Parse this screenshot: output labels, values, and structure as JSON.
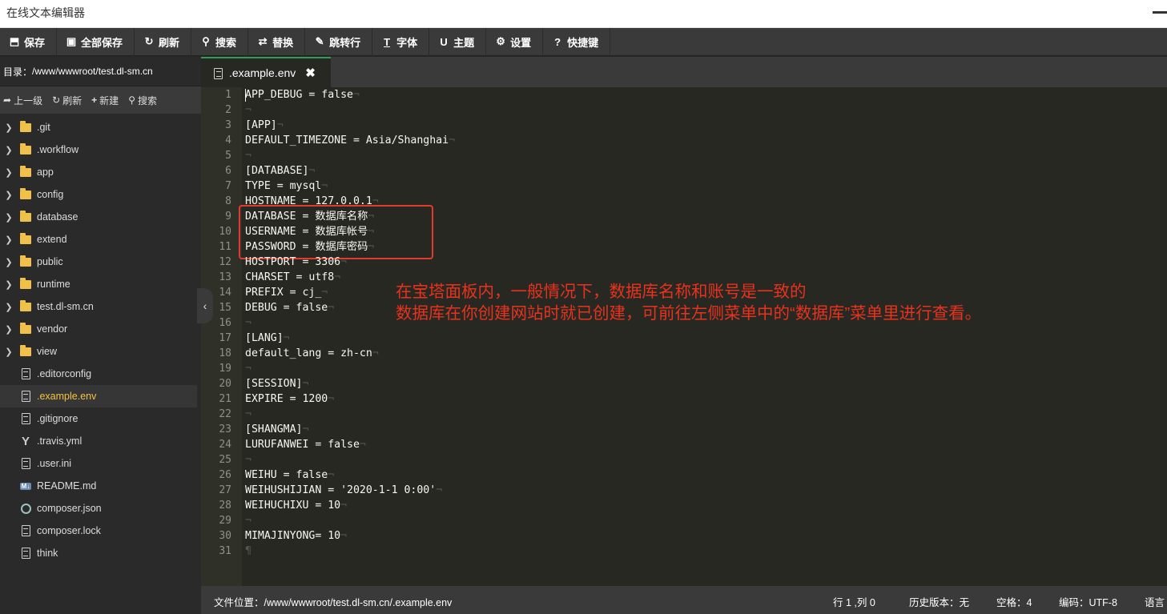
{
  "app": {
    "title": "在线文本编辑器"
  },
  "toolbar": {
    "buttons": [
      {
        "label": "保存",
        "icon": "save-icon"
      },
      {
        "label": "全部保存",
        "icon": "save-all-icon"
      },
      {
        "label": "刷新",
        "icon": "refresh-icon"
      },
      {
        "label": "搜索",
        "icon": "search-icon"
      },
      {
        "label": "替换",
        "icon": "replace-icon"
      },
      {
        "label": "跳转行",
        "icon": "pin-icon"
      },
      {
        "label": "字体",
        "icon": "font-icon"
      },
      {
        "label": "主题",
        "icon": "magnet-icon"
      },
      {
        "label": "设置",
        "icon": "gear-icon"
      },
      {
        "label": "快捷键",
        "icon": "help-icon"
      }
    ]
  },
  "sidebar": {
    "directory_label": "目录：",
    "directory_path": "/www/wwwroot/test.dl-sm.cn",
    "tools": [
      {
        "label": "上一级",
        "icon": "arrow-up-icon"
      },
      {
        "label": "刷新",
        "icon": "refresh-icon"
      },
      {
        "label": "新建",
        "icon": "plus-icon"
      },
      {
        "label": "搜索",
        "icon": "search-icon"
      }
    ],
    "items": [
      {
        "name": ".git",
        "type": "folder"
      },
      {
        "name": ".workflow",
        "type": "folder"
      },
      {
        "name": "app",
        "type": "folder"
      },
      {
        "name": "config",
        "type": "folder"
      },
      {
        "name": "database",
        "type": "folder"
      },
      {
        "name": "extend",
        "type": "folder"
      },
      {
        "name": "public",
        "type": "folder"
      },
      {
        "name": "runtime",
        "type": "folder"
      },
      {
        "name": "test.dl-sm.cn",
        "type": "folder"
      },
      {
        "name": "vendor",
        "type": "folder"
      },
      {
        "name": "view",
        "type": "folder"
      },
      {
        "name": ".editorconfig",
        "type": "file"
      },
      {
        "name": ".example.env",
        "type": "file",
        "active": true
      },
      {
        "name": ".gitignore",
        "type": "file"
      },
      {
        "name": ".travis.yml",
        "type": "yml"
      },
      {
        "name": ".user.ini",
        "type": "file"
      },
      {
        "name": "README.md",
        "type": "md"
      },
      {
        "name": "composer.json",
        "type": "json"
      },
      {
        "name": "composer.lock",
        "type": "file"
      },
      {
        "name": "think",
        "type": "file"
      }
    ]
  },
  "tab": {
    "label": ".example.env",
    "close": "✖"
  },
  "editor": {
    "lines": [
      "APP_DEBUG = false",
      "",
      "[APP]",
      "DEFAULT_TIMEZONE = Asia/Shanghai",
      "",
      "[DATABASE]",
      "TYPE = mysql",
      "HOSTNAME = 127.0.0.1",
      "DATABASE = 数据库名称",
      "USERNAME = 数据库帐号",
      "PASSWORD = 数据库密码",
      "HOSTPORT = 3306",
      "CHARSET = utf8",
      "PREFIX = cj_",
      "DEBUG = false",
      "",
      "[LANG]",
      "default_lang = zh-cn",
      "",
      "[SESSION]",
      "EXPIRE = 1200",
      "",
      "[SHANGMA]",
      "LURUFANWEI = false",
      "",
      "WEIHU = false",
      "WEIHUSHIJIAN = '2020-1-1 0:00'",
      "WEIHUCHIXU = 10",
      "",
      "MIMAJINYONG= 10",
      ""
    ],
    "eol_marker": "¬",
    "last_marker": "¶",
    "annotation_line1": "在宝塔面板内，一般情况下，数据库名称和账号是一致的",
    "annotation_line2": "数据库在你创建网站时就已创建，可前往左侧菜单中的“数据库”菜单里进行查看。"
  },
  "status": {
    "file_label": "文件位置：",
    "file_path": "/www/wwwroot/test.dl-sm.cn/.example.env",
    "position": "行 1 ,列 0",
    "history": "历史版本：无",
    "spaces": "空格：4",
    "encoding": "编码：UTF-8",
    "language": "语言"
  },
  "colors": {
    "accent_tab": "#2e9e5a",
    "annotation": "#e8321e",
    "active_file": "#f4c541",
    "editor_bg": "#272822"
  }
}
